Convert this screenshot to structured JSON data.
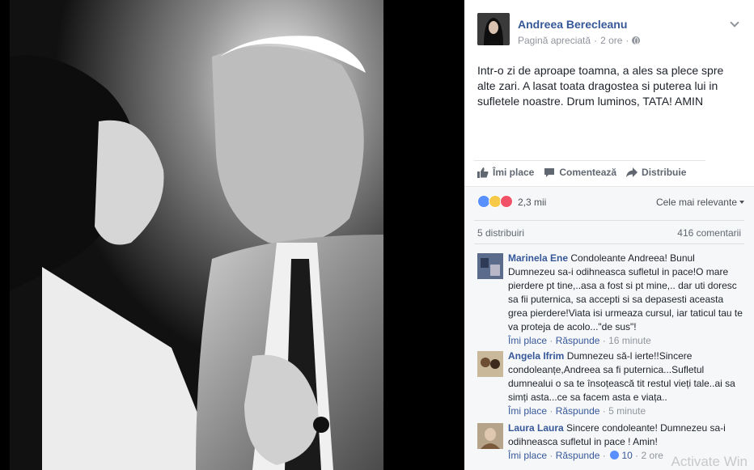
{
  "post": {
    "author": "Andreea Berecleanu",
    "meta_type": "Pagină apreciată",
    "meta_time": "2 ore",
    "text": "Intr-o zi de aproape toamna, a ales sa plece spre alte zari. A lasat toata dragostea si puterea lui in sufletele noastre. Drum luminos, TATA! AMIN",
    "actions": {
      "like": "Îmi place",
      "comment": "Comentează",
      "share": "Distribuie"
    },
    "reactions_count": "2,3 mii",
    "sort_label": "Cele mai relevante",
    "shares": "5 distribuiri",
    "comments_count": "416 comentarii"
  },
  "comments": [
    {
      "author": "Marinela Ene",
      "text": "Condoleante Andreea! Bunul Dumnezeu sa-i odihneasca sufletul in pace!O mare pierdere pt tine,..asa a fost si pt mine,.. dar uti doresc sa fii puternica, sa accepti si sa depasesti aceasta grea pierdere!Viata isi urmeaza cursul, iar taticul tau te va proteja de acolo...\"de sus\"!",
      "like": "Îmi place",
      "reply": "Răspunde",
      "time": "16 minute",
      "likes": ""
    },
    {
      "author": "Angela Ifrim",
      "text": "Dumnezeu să-l ierte!!Sincere condoleanțe,Andreea sa fi puternica...Sufletul dumnealui o sa te însoțească tit restul vieți tale..ai sa simți asta...ce sa facem asta e viața..",
      "like": "Îmi place",
      "reply": "Răspunde",
      "time": "5 minute",
      "likes": ""
    },
    {
      "author": "Laura Laura",
      "text": "Sincere condoleante! Dumnezeu sa-i odihneasca sufletul in pace ! Amin!",
      "like": "Îmi place",
      "reply": "Răspunde",
      "time": "2 ore",
      "likes": "10"
    }
  ],
  "watermark": "Activate Win",
  "colors": {
    "link": "#365899",
    "meta": "#90949c",
    "like_blue": "#5890ff"
  },
  "icons": [
    "thumbs-up-icon",
    "comment-icon",
    "share-arrow-icon",
    "globe-icon",
    "chevron-down-icon"
  ]
}
